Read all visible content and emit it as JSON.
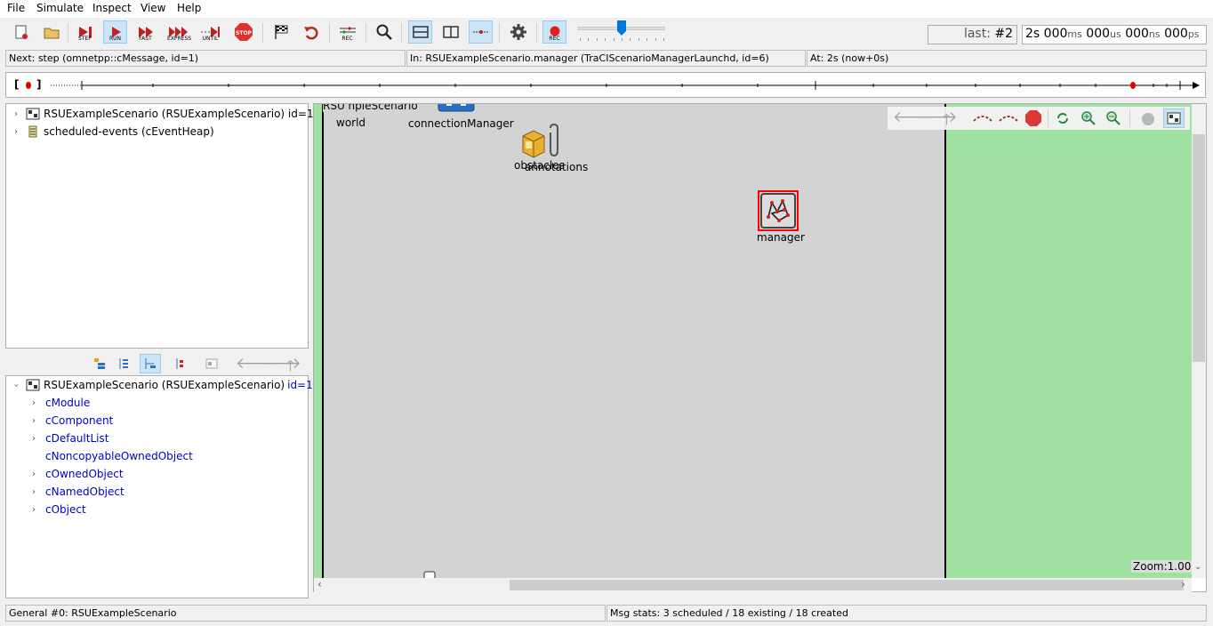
{
  "menu": [
    "File",
    "Simulate",
    "Inspect",
    "View",
    "Help"
  ],
  "toolbar": {
    "step": "STEP",
    "run": "RUN",
    "fast": "FAST",
    "express": "EXPRESS",
    "until": "UNTIL",
    "stop": "STOP",
    "rec1": "REC",
    "rec2": "REC",
    "speed_fraction": 0.5
  },
  "event_counter": {
    "prefix": "last: ",
    "value": "#2"
  },
  "sim_time": {
    "s": "2s",
    "ms": "000",
    "ms_unit": "ms",
    "us": "000",
    "us_unit": "us",
    "ns": "000",
    "ns_unit": "ns",
    "ps": "000",
    "ps_unit": "ps"
  },
  "status": {
    "next": "Next: step (omnetpp::cMessage, id=1)",
    "in": "In: RSUExampleScenario.manager (TraCIScenarioManagerLaunchd, id=6)",
    "at": "At: 2s (now+0s)"
  },
  "timeline": {
    "left_bracket": "[",
    "right_bracket": "]"
  },
  "object_tree": [
    {
      "label": "RSUExampleScenario (RSUExampleScenario) id=1",
      "icon": "module-icon"
    },
    {
      "label": "scheduled-events (cEventHeap)",
      "icon": "event-heap-icon"
    }
  ],
  "inspector": {
    "root_label": "RSUExampleScenario (RSUExampleScenario) ",
    "root_id": "id=1",
    "classes": [
      {
        "label": "cModule",
        "expandable": true
      },
      {
        "label": "cComponent",
        "expandable": true
      },
      {
        "label": "cDefaultList",
        "expandable": true
      },
      {
        "label": "cNoncopyableOwnedObject",
        "expandable": false
      },
      {
        "label": "cOwnedObject",
        "expandable": true
      },
      {
        "label": "cNamedObject",
        "expandable": true
      },
      {
        "label": "cObject",
        "expandable": true
      }
    ]
  },
  "canvas": {
    "scenario_label_partial": "RSU      npleScenario",
    "modules": [
      "world",
      "connectionManager",
      "obstacles",
      "annotations",
      "manager"
    ],
    "zoom": "Zoom:1.00x"
  },
  "bottom_status": {
    "left": "General #0: RSUExampleScenario",
    "right": "Msg stats: 3 scheduled / 18 existing / 18 created"
  },
  "colors": {
    "playground": "#a0e0a0",
    "network_bg": "#d3d3d3",
    "selected_module": "#ff0000",
    "accent": "#0060c0"
  }
}
